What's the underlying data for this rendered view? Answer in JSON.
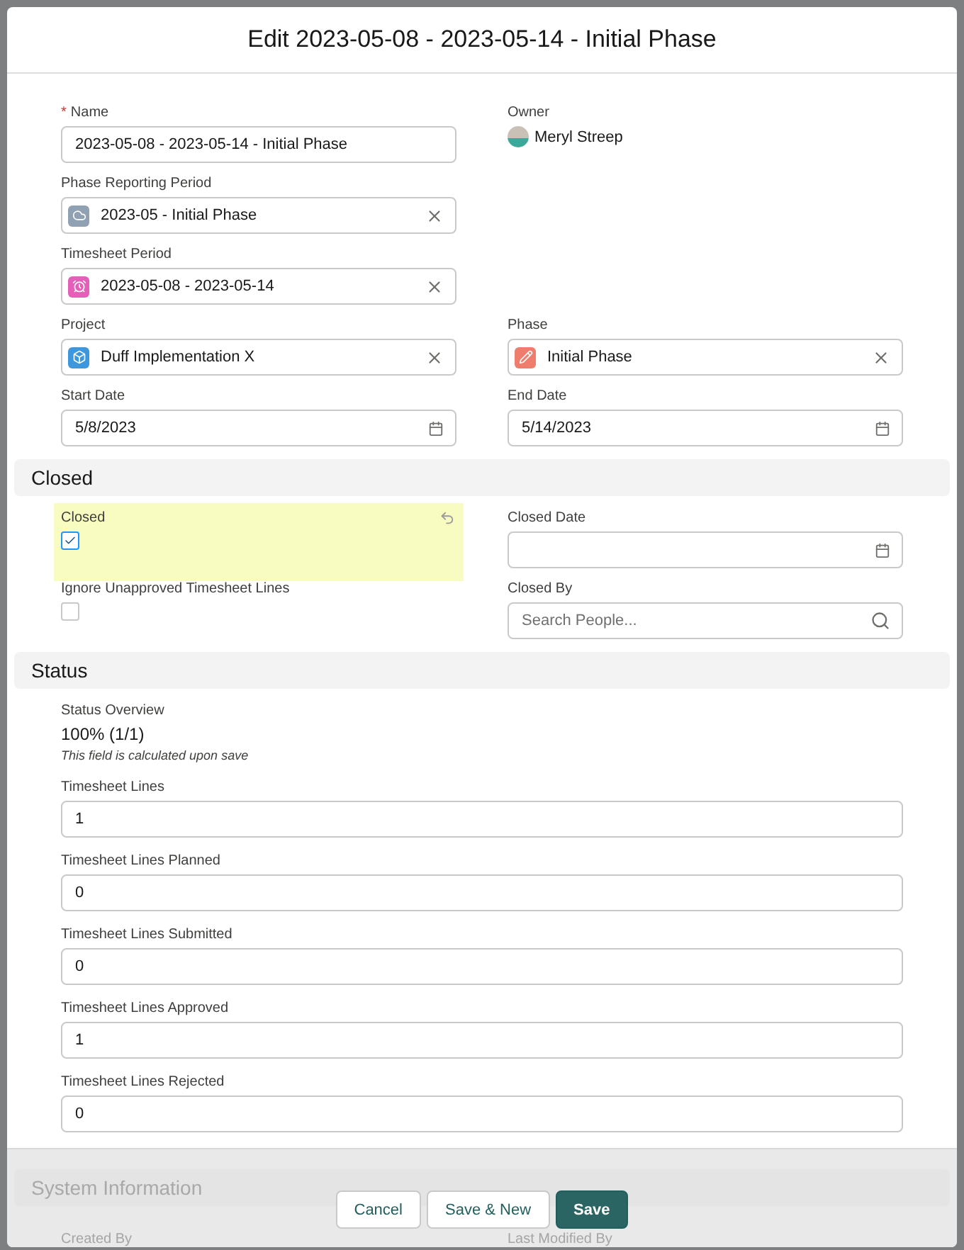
{
  "modal": {
    "title": "Edit 2023-05-08 - 2023-05-14 - Initial Phase"
  },
  "sections": [
    {
      "kind": "two-column",
      "rows": [
        [
          {
            "kind": "text",
            "label": "Name",
            "required_mark": "*",
            "value": "2023-05-08 - 2023-05-14 - Initial Phase"
          },
          {
            "kind": "owner",
            "label": "Owner",
            "value": "Meryl Streep"
          }
        ],
        [
          {
            "kind": "lookup",
            "label": "Phase Reporting Period",
            "value": "2023-05 - Initial Phase",
            "color": "#8fa1b3"
          }
        ],
        [
          {
            "kind": "lookup",
            "label": "Timesheet Period",
            "value": "2023-05-08 - 2023-05-14",
            "color": "#e45fb8"
          }
        ],
        [
          {
            "kind": "lookup",
            "label": "Project",
            "value": "Duff Implementation X",
            "color": "#3c97dd"
          },
          {
            "kind": "lookup",
            "label": "Phase",
            "value": "Initial Phase",
            "color": "#ef7d6d"
          }
        ],
        [
          {
            "kind": "date",
            "label": "Start Date",
            "value": "5/8/2023"
          },
          {
            "kind": "date",
            "label": "End Date",
            "value": "5/14/2023"
          }
        ]
      ]
    },
    {
      "heading": "Closed",
      "kind": "two-column",
      "rows": [
        [
          {
            "kind": "checkbox",
            "label": "Closed",
            "checked": true,
            "modified": true
          },
          {
            "kind": "date",
            "label": "Closed Date"
          }
        ],
        [
          {
            "kind": "checkbox",
            "label": "Ignore Unapproved Timesheet Lines",
            "checked": false,
            "modified": false
          },
          {
            "kind": "search",
            "label": "Closed By",
            "placeholder": "Search People..."
          }
        ]
      ]
    },
    {
      "heading": "Status",
      "kind": "one-column",
      "rows": [
        [
          {
            "kind": "readonly",
            "label": "Status Overview",
            "value": "100% (1/1)",
            "note": "This field is calculated upon save"
          }
        ],
        [
          {
            "kind": "text",
            "label": "Timesheet Lines",
            "value": "1"
          }
        ],
        [
          {
            "kind": "text",
            "label": "Timesheet Lines Planned",
            "value": "0"
          }
        ],
        [
          {
            "kind": "text",
            "label": "Timesheet Lines Submitted",
            "value": "0"
          }
        ],
        [
          {
            "kind": "text",
            "label": "Timesheet Lines Approved",
            "value": "1"
          }
        ],
        [
          {
            "kind": "text",
            "label": "Timesheet Lines Rejected",
            "value": "0"
          }
        ]
      ]
    },
    {
      "heading": "System Information",
      "kind": "faded",
      "rows": [
        [
          {
            "kind": "label",
            "label": "Created By"
          },
          {
            "kind": "label",
            "label": "Last Modified By"
          }
        ]
      ]
    }
  ],
  "buttons": [
    {
      "label": "Cancel",
      "kind": "neutral"
    },
    {
      "label": "Save & New",
      "kind": "neutral"
    },
    {
      "label": "Save",
      "kind": "brand"
    }
  ]
}
